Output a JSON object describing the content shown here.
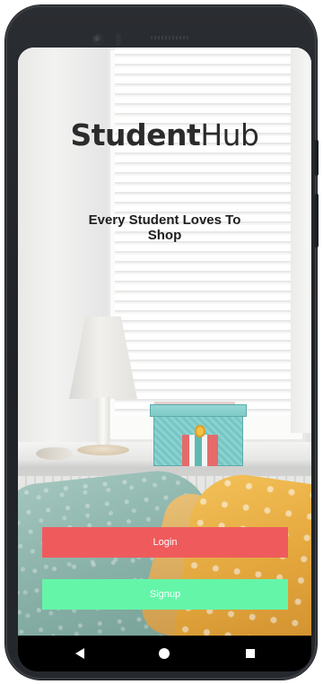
{
  "app": {
    "brand_bold": "Student",
    "brand_light": "Hub",
    "tagline": "Every Student Loves To Shop"
  },
  "actions": {
    "login_label": "Login",
    "signup_label": "Signup"
  },
  "colors": {
    "login_button": "#ef5b5d",
    "signup_button": "#64f5a9",
    "navbar": "#000000"
  },
  "navigation": {
    "back_icon": "triangle-back-icon",
    "home_icon": "circle-home-icon",
    "recent_icon": "square-recent-apps-icon"
  }
}
